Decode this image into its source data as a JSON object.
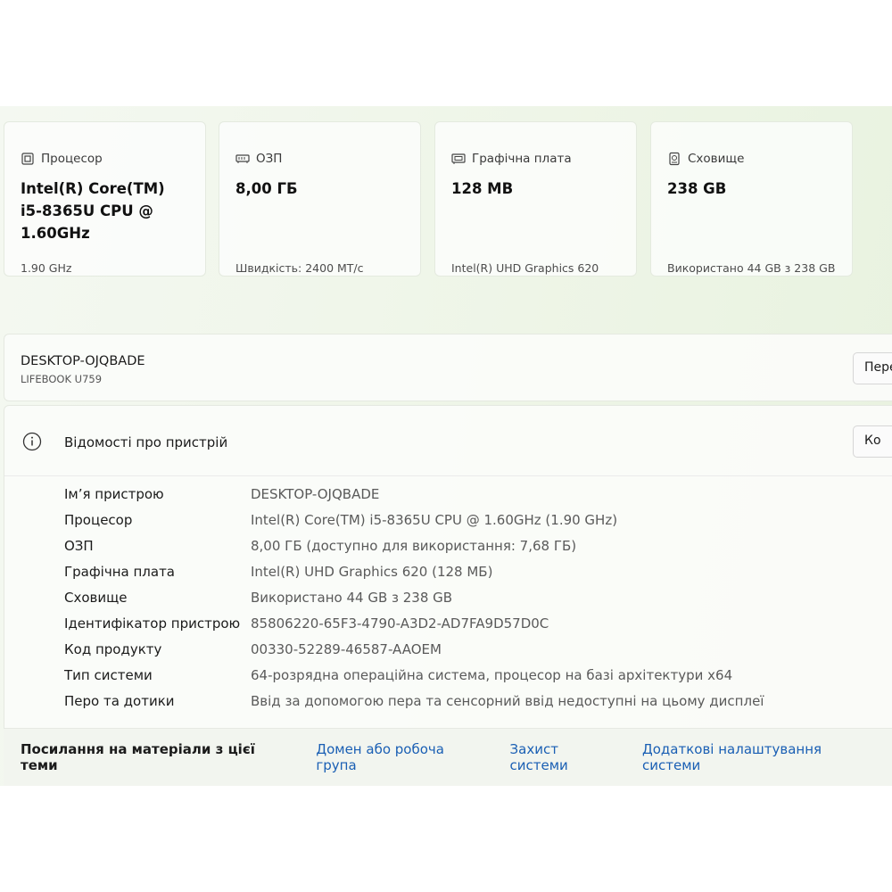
{
  "cards": [
    {
      "icon": "processor-icon",
      "title": "Процесор",
      "value": "Intel(R) Core(TM) i5-8365U CPU @ 1.60GHz",
      "sub": "1.90 GHz"
    },
    {
      "icon": "ram-icon",
      "title": "ОЗП",
      "value": "8,00 ГБ",
      "sub": "Швидкість: 2400 MT/c"
    },
    {
      "icon": "graphics-card-icon",
      "title": "Графічна плата",
      "value": "128 MB",
      "sub": "Intel(R) UHD Graphics 620"
    },
    {
      "icon": "storage-icon",
      "title": "Сховище",
      "value": "238 GB",
      "sub": "Використано 44 GB з 238 GB"
    }
  ],
  "device": {
    "name": "DESKTOP-OJQBADE",
    "model": "LIFEBOOK U759",
    "rename_label": "Пере"
  },
  "info": {
    "title": "Відомості про пристрій",
    "copy_label": "Ко",
    "rows": [
      {
        "label": "Ім’я пристрою",
        "value": "DESKTOP-OJQBADE"
      },
      {
        "label": "Процесор",
        "value": "Intel(R) Core(TM) i5-8365U CPU @ 1.60GHz (1.90 GHz)"
      },
      {
        "label": "ОЗП",
        "value": "8,00 ГБ (доступно для використання: 7,68 ГБ)"
      },
      {
        "label": "Графічна плата",
        "value": "Intel(R) UHD Graphics 620 (128 МБ)"
      },
      {
        "label": "Сховище",
        "value": "Використано 44 GB з 238 GB"
      },
      {
        "label": "Ідентифікатор пристрою",
        "value": "85806220-65F3-4790-A3D2-AD7FA9D57D0C"
      },
      {
        "label": "Код продукту",
        "value": "00330-52289-46587-AAOEM"
      },
      {
        "label": "Тип системи",
        "value": "64-розрядна операційна система, процесор на базі архітектури x64"
      },
      {
        "label": "Перо та дотики",
        "value": "Ввід за допомогою пера та сенсорний ввід недоступні на цьому дисплеї"
      }
    ]
  },
  "related": {
    "title": "Посилання на матеріали з цієї теми",
    "links": [
      "Домен або робоча група",
      "Захист системи",
      "Додаткові налаштування системи"
    ]
  },
  "colors": {
    "accent_link": "#1a5fb4",
    "background_tint": "#eef5e7"
  }
}
